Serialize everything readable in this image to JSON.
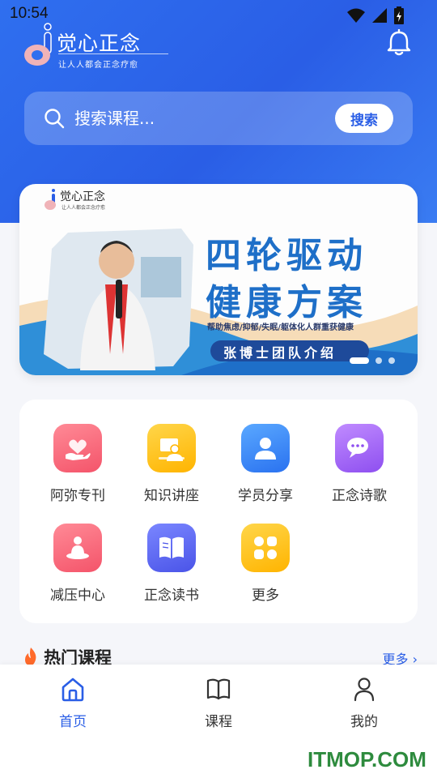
{
  "status_bar": {
    "time": "10:54"
  },
  "header": {
    "app_title": "觉心正念",
    "app_subtitle": "让人人都会正念疗愈"
  },
  "search": {
    "placeholder": "搜索课程...",
    "button_label": "搜索"
  },
  "banner": {
    "logo_title": "觉心正念",
    "logo_subtitle": "让人人都会正念疗愈",
    "line1": "四轮驱动",
    "line2": "健康方案",
    "tagline": "帮助焦虑/抑郁/失眠/躯体化人群重获健康",
    "cta": "张博士团队介绍",
    "active_slide": 1,
    "slide_count": 3
  },
  "features": [
    {
      "label": "阿弥专刊",
      "icon": "heart-hand-icon",
      "color_from": "#ff8a96",
      "color_to": "#f4546a"
    },
    {
      "label": "知识讲座",
      "icon": "lecture-icon",
      "color_from": "#ffd64a",
      "color_to": "#ffb400"
    },
    {
      "label": "学员分享",
      "icon": "user-icon",
      "color_from": "#5aa8ff",
      "color_to": "#2a72f0"
    },
    {
      "label": "正念诗歌",
      "icon": "chat-bubble-icon",
      "color_from": "#c08bff",
      "color_to": "#8e4ff0"
    },
    {
      "label": "减压中心",
      "icon": "meditation-icon",
      "color_from": "#ff8a96",
      "color_to": "#f4546a"
    },
    {
      "label": "正念读书",
      "icon": "book-icon",
      "color_from": "#7a86ff",
      "color_to": "#4a54e8"
    },
    {
      "label": "更多",
      "icon": "more-grid-icon",
      "color_from": "#ffd64a",
      "color_to": "#ffb400"
    }
  ],
  "hot_courses": {
    "title": "热门课程",
    "more_label": "更多 ›"
  },
  "bottom_nav": [
    {
      "label": "首页",
      "icon": "home-icon",
      "active": true
    },
    {
      "label": "课程",
      "icon": "open-book-icon",
      "active": false
    },
    {
      "label": "我的",
      "icon": "profile-icon",
      "active": false
    }
  ],
  "watermark": "ITMOP.COM",
  "colors": {
    "primary": "#2a5ee6",
    "banner_text": "#1e6fc8"
  }
}
